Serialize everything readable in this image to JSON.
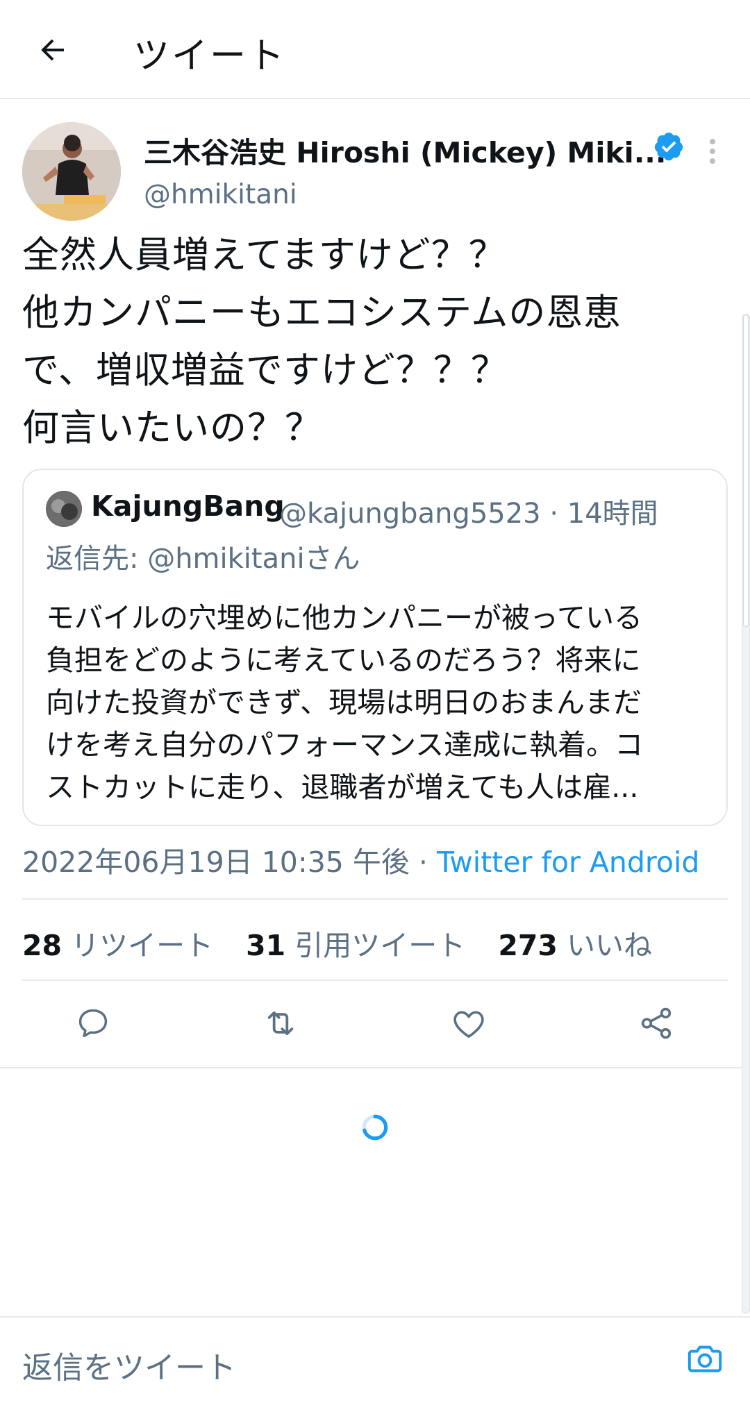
{
  "header": {
    "title": "ツイート",
    "back_icon": "arrow-left-icon"
  },
  "tweet": {
    "author_name": "三木谷浩史 Hiroshi (Mickey) Miki...",
    "handle": "@hmikitani",
    "text_lines": [
      "全然人員増えてますけど？？",
      "他カンパニーもエコシステムの恩恵",
      "で、増収増益ですけど？？？",
      "何言いたいの？？"
    ],
    "timestamp": "2022年06月19日 10:35 午後 · ",
    "client": "Twitter for Android"
  },
  "quote": {
    "name": "KajungBang",
    "meta": "@kajungbang5523 · 14時間",
    "reply_to": "返信先: @hmikitaniさん",
    "body_lines": [
      "モバイルの穴埋めに他カンパニーが被っている",
      "負担をどのように考えているのだろう？将来に",
      "向けた投資ができず、現場は明日のおまんまだ",
      "けを考え自分のパフォーマンス達成に執着。コ",
      "ストカットに走り、退職者が増えても人は雇..."
    ]
  },
  "stats": {
    "retweets_count": "28",
    "retweets_label": "リツイート",
    "quotes_count": "31",
    "quotes_label": "引用ツイート",
    "likes_count": "273",
    "likes_label": "いいね"
  },
  "actions": [
    "reply-icon",
    "retweet-icon",
    "like-icon",
    "share-icon"
  ],
  "reply_bar": {
    "placeholder": "返信をツイート",
    "camera_icon": "camera-icon"
  },
  "colors": {
    "accent": "#1d9bf0",
    "secondary_text": "#5b7083",
    "primary_text": "#0f1419"
  }
}
